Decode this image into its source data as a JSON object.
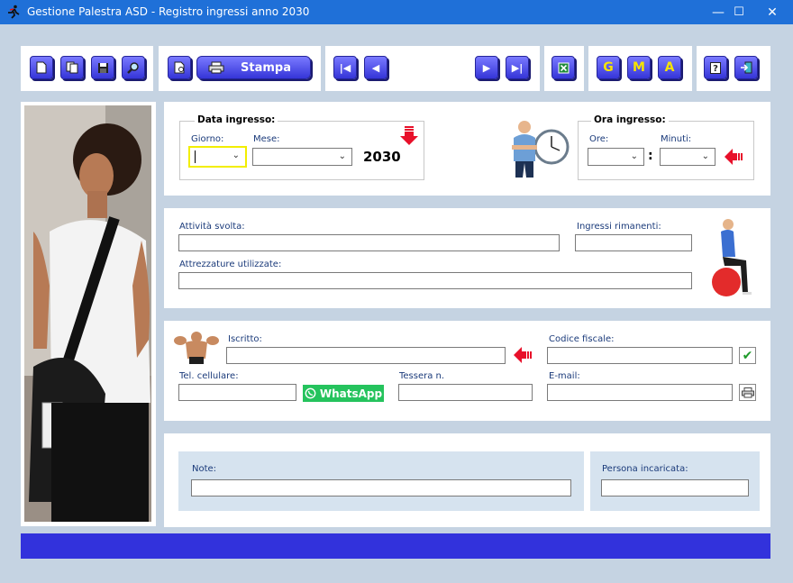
{
  "window": {
    "title": "Gestione Palestra ASD - Registro ingressi anno 2030",
    "minimize": "—",
    "maximize": "☐",
    "close": "✕"
  },
  "toolbar": {
    "new_icon": "new-document-icon",
    "copy_icon": "copy-icon",
    "save_icon": "save-icon",
    "search_icon": "search-icon",
    "preview_icon": "print-preview-icon",
    "print_label": "Stampa",
    "first": "|◀",
    "prev": "◀",
    "next": "▶",
    "last": "▶|",
    "excel_icon": "excel-icon",
    "g_label": "G",
    "m_label": "M",
    "a_label": "A",
    "help_label": "?",
    "exit_icon": "exit-icon"
  },
  "date_section": {
    "title": "Data ingresso:",
    "day_label": "Giorno:",
    "month_label": "Mese:",
    "year": "2030",
    "day_value": "",
    "month_value": ""
  },
  "time_section": {
    "title": "Ora ingresso:",
    "hours_label": "Ore:",
    "minutes_label": "Minuti:",
    "separator": ":",
    "hours_value": "",
    "minutes_value": ""
  },
  "activity_section": {
    "activity_label": "Attività svolta:",
    "remaining_label": "Ingressi rimanenti:",
    "equipment_label": "Attrezzature utilizzate:",
    "activity_value": "",
    "remaining_value": "",
    "equipment_value": ""
  },
  "member_section": {
    "member_label": "Iscritto:",
    "tax_code_label": "Codice fiscale:",
    "phone_label": "Tel. cellulare:",
    "card_label": "Tessera n.",
    "email_label": "E-mail:",
    "whatsapp_label": "WhatsApp",
    "member_value": "",
    "tax_code_value": "",
    "phone_value": "",
    "card_value": "",
    "email_value": ""
  },
  "notes_section": {
    "notes_label": "Note:",
    "staff_label": "Persona incaricata:",
    "notes_value": "",
    "staff_value": ""
  },
  "colors": {
    "titlebar": "#1f70d8",
    "button": "#4a4af0",
    "statusbar": "#3232dc",
    "whatsapp": "#25c35d",
    "arrow": "#e8102a"
  }
}
